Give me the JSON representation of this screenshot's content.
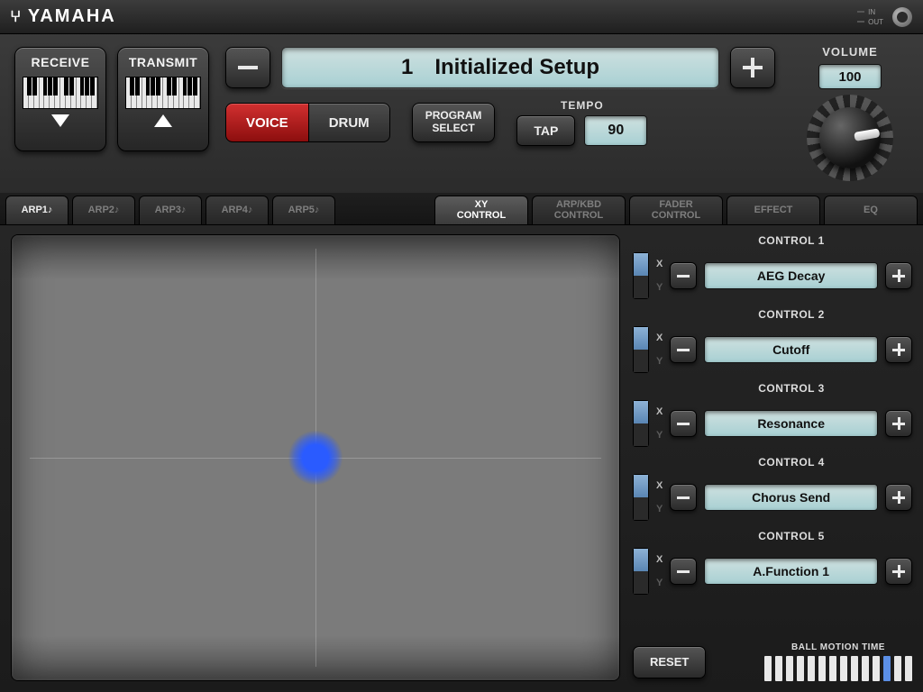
{
  "brand": "YAMAHA",
  "io": {
    "in_label": "IN",
    "out_label": "OUT"
  },
  "receive_label": "RECEIVE",
  "transmit_label": "TRANSMIT",
  "setup": {
    "number": "1",
    "name": "Initialized Setup"
  },
  "mode": {
    "voice_label": "VOICE",
    "drum_label": "DRUM",
    "active": "voice"
  },
  "program_select": {
    "line1": "PROGRAM",
    "line2": "SELECT"
  },
  "tempo": {
    "label": "TEMPO",
    "tap_label": "TAP",
    "value": "90"
  },
  "volume": {
    "label": "VOLUME",
    "value": "100"
  },
  "tabs": {
    "arp": [
      "ARP1♪",
      "ARP2♪",
      "ARP3♪",
      "ARP4♪",
      "ARP5♪"
    ],
    "arp_active_index": 0,
    "xy": {
      "line1": "XY",
      "line2": "CONTROL"
    },
    "arp_kbd": {
      "line1": "ARP/KBD",
      "line2": "CONTROL"
    },
    "fader": {
      "line1": "FADER",
      "line2": "CONTROL"
    },
    "effect": "EFFECT",
    "eq": "EQ",
    "selected": "xy"
  },
  "xy_ball": {
    "x_pct": 50,
    "y_pct": 50
  },
  "controls": [
    {
      "title": "CONTROL 1",
      "axis": "X",
      "value": "AEG Decay"
    },
    {
      "title": "CONTROL 2",
      "axis": "X",
      "value": "Cutoff"
    },
    {
      "title": "CONTROL 3",
      "axis": "X",
      "value": "Resonance"
    },
    {
      "title": "CONTROL 4",
      "axis": "X",
      "value": "Chorus Send"
    },
    {
      "title": "CONTROL 5",
      "axis": "X",
      "value": "A.Function 1"
    }
  ],
  "axis_labels": {
    "x": "X",
    "y": "Y"
  },
  "reset_label": "RESET",
  "ball_motion": {
    "label": "BALL MOTION TIME",
    "bars": 14,
    "highlight_index": 11
  }
}
